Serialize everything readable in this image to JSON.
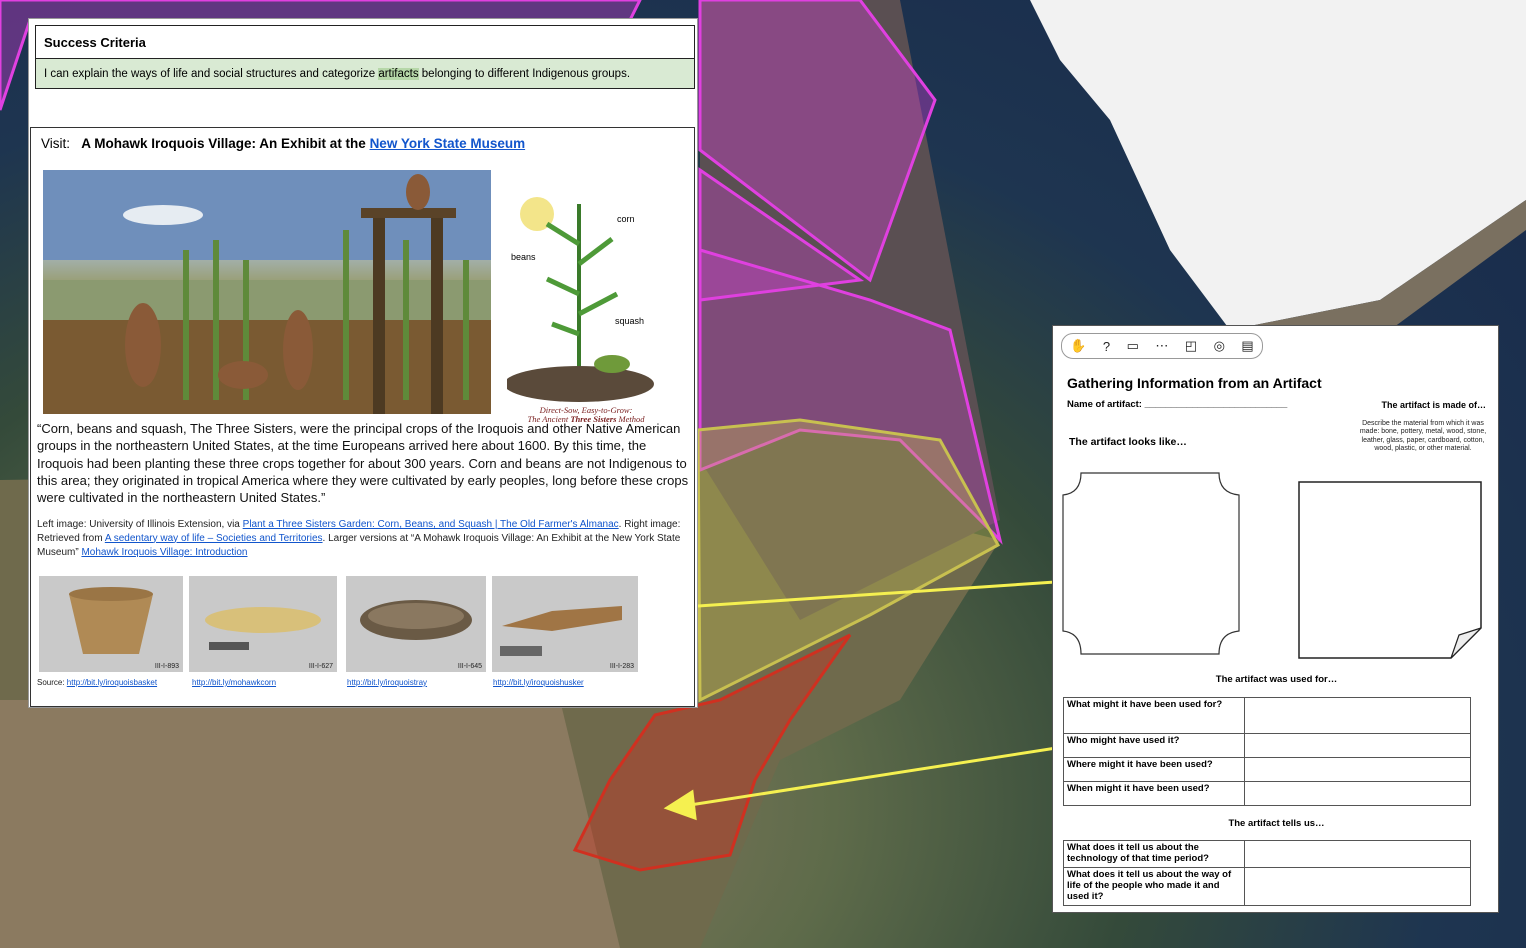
{
  "map": {
    "regions": [
      {
        "name": "magenta-region",
        "color": "#e040e0"
      },
      {
        "name": "yellow-region",
        "color": "#c8c050"
      },
      {
        "name": "red-region",
        "color": "#d03020"
      }
    ],
    "arrow_color": "#f5f050"
  },
  "document": {
    "success_criteria": {
      "heading": "Success Criteria",
      "text_before": "I can explain the ways of life and social structures and categorize ",
      "highlight": "artifacts",
      "text_after": " belonging to different Indigenous groups."
    },
    "visit": {
      "prefix": "Visit:",
      "title": "A Mohawk Iroquois Village: An Exhibit at the ",
      "link": "New York State Museum"
    },
    "three_sisters": {
      "labels": {
        "corn": "corn",
        "beans": "beans",
        "squash": "squash"
      },
      "caption1": "Direct-Sow, Easy-to-Grow:",
      "caption2_a": "The Ancient ",
      "caption2_b": "Three Sisters",
      "caption2_c": " Method"
    },
    "quote": "“Corn, beans and squash, The Three Sisters, were the principal crops of the Iroquois and other Native American groups in the northeastern United States, at the time Europeans arrived here about 1600. By this time, the Iroquois had been planting these three crops together for about 300 years. Corn and beans are not Indigenous to this area; they originated in tropical America where they were cultivated by early peoples, long before these crops were cultivated in the northeastern United States.”",
    "credit": {
      "t1": "Left image: University of Illinois Extension, via ",
      "l1": "Plant a Three Sisters Garden: Corn, Beans, and Squash | The Old Farmer's Almanac",
      "t2": ". Right image:  Retrieved from ",
      "l2": "A sedentary way of life – Societies and Territories",
      "t3": ".  Larger versions at “A Mohawk Iroquois Village: An Exhibit at the New York State Museum”  ",
      "l3": "Mohawk Iroquois Village: Introduction"
    },
    "artifacts": [
      {
        "tag": "III-I-893",
        "source": "http://bit.ly/iroquoisbasket"
      },
      {
        "tag": "III-I-627",
        "source": "http://bit.ly/mohawkcorn"
      },
      {
        "tag": "III-I-645",
        "source": "http://bit.ly/iroquoistray"
      },
      {
        "tag": "III-I-283",
        "source": "http://bit.ly/iroquoishusker"
      }
    ],
    "source_prefix": "Source: "
  },
  "worksheet": {
    "toolbar": [
      "hand-icon",
      "question-icon",
      "cards-icon",
      "path-icon",
      "chat-icon",
      "target-icon",
      "book-icon"
    ],
    "title": "Gathering Information from an Artifact",
    "name_label": "Name of artifact: ___________________________",
    "made_of": "The artifact is made of…",
    "made_desc": "Describe the material from which it was made: bone, pottery, metal, wood, stone, leather, glass, paper, cardboard, cotton, wood, plastic, or other material.",
    "looks_like": "The artifact looks like…",
    "used_for_heading": "The artifact was used for…",
    "used_for_rows": [
      "What might it have been used for?",
      "Who might have used it?",
      "Where might it have been used?",
      "When might it have been used?"
    ],
    "tells_heading": "The artifact tells us…",
    "tells_rows": [
      "What does it tell us about the technology of that time period?",
      "What does it tell us about the way of life of the people who made it and used it?"
    ]
  }
}
